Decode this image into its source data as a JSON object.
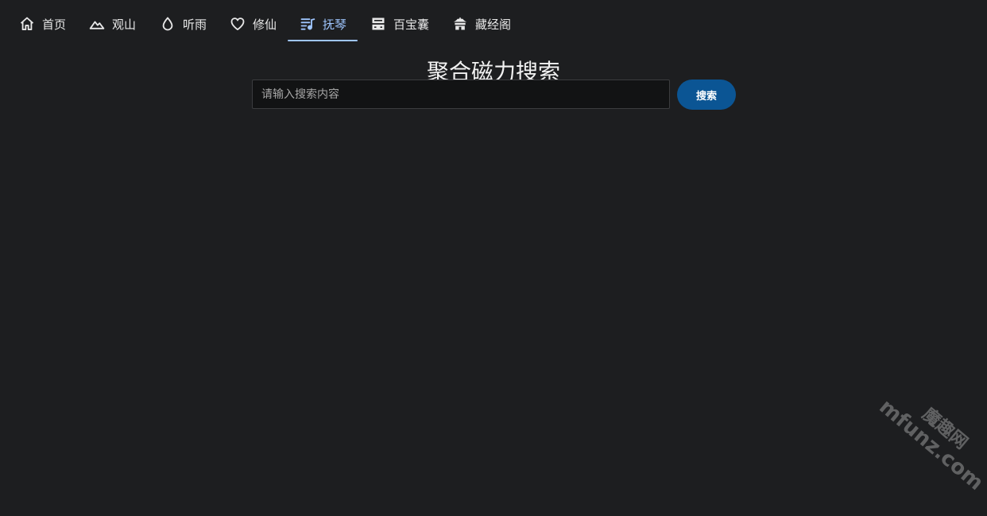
{
  "nav": {
    "items": [
      {
        "label": "首页",
        "icon": "home-icon",
        "active": false
      },
      {
        "label": "观山",
        "icon": "mountain-icon",
        "active": false
      },
      {
        "label": "听雨",
        "icon": "water-drop-icon",
        "active": false
      },
      {
        "label": "修仙",
        "icon": "heart-icon",
        "active": false
      },
      {
        "label": "抚琴",
        "icon": "music-sheet-icon",
        "active": true
      },
      {
        "label": "百宝囊",
        "icon": "inbox-tray-icon",
        "active": false
      },
      {
        "label": "藏经阁",
        "icon": "temple-icon",
        "active": false
      }
    ]
  },
  "page": {
    "title": "聚合磁力搜索"
  },
  "search": {
    "value": "",
    "placeholder": "请输入搜索内容",
    "button_label": "搜索"
  },
  "watermark": {
    "cn": "魔趣网",
    "en": "mfunz.com"
  },
  "colors": {
    "background": "#1d1e20",
    "accent": "#9fc6ff",
    "button": "#0b5594"
  }
}
